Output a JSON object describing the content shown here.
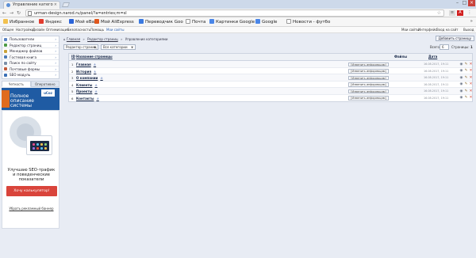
{
  "browser": {
    "tab_title": "Управление катего",
    "url": "urman-design.narod.ru/panel/?a=entries;m=sl",
    "bookmarks": [
      {
        "label": "Избранное",
        "color": "#f2c14e"
      },
      {
        "label": "Яндекс",
        "color": "#e23b2e"
      },
      {
        "label": "Мой eBay",
        "color": "#2b64d8"
      },
      {
        "label": "Мой AliExpress",
        "color": "#e0571c"
      },
      {
        "label": "Переводчик Goo",
        "color": "#3a79e0"
      },
      {
        "label": "Почта",
        "color": "#f6f6f6"
      },
      {
        "label": "Картинки Google",
        "color": "#4a86e8"
      },
      {
        "label": "Google",
        "color": "#4a86e8"
      },
      {
        "label": "Новости - футбо",
        "color": "#f6f6f6"
      }
    ],
    "bookmarks_more": "»",
    "ya_bar_left": [
      "Общее",
      "Настройки",
      "Дизайн",
      "Оптимизация",
      "Безопасность",
      "Помощь",
      "Мои сайты"
    ],
    "ya_bar_right": [
      "Мои сайты",
      "Интерфейс",
      "Вход на сайт",
      "Выход"
    ]
  },
  "sidebar": {
    "menu": [
      {
        "label": "Пользователи",
        "color": "#5a83c4"
      },
      {
        "label": "Редактор страниц",
        "color": "#4f9b46"
      },
      {
        "label": "Менеджер файлов",
        "color": "#c9a33a"
      },
      {
        "label": "Гостевая книга",
        "color": "#4c7bb8"
      },
      {
        "label": "Поиск по сайту",
        "color": "#7b8fa8"
      },
      {
        "label": "Почтовые формы",
        "color": "#c05a3a"
      },
      {
        "label": "SEO модуль",
        "color": "#3a6fb5"
      }
    ],
    "tabs": [
      "Четкость",
      "Оперативно"
    ],
    "promo1_text": [
      "Полное",
      "описание",
      "системы"
    ],
    "promo1_badge": "uCoz",
    "promo2": {
      "title_lines": [
        "Улучшаю SEO-трафик",
        "и поведенческие",
        "показатели"
      ],
      "cta": "Хочу калькулятор!",
      "banner_link": "Убрать рекламный баннер"
    }
  },
  "main": {
    "breadcrumbs": [
      "Главная",
      "Редактор страниц",
      "Управление категориями"
    ],
    "add_button": "Добавить страницу",
    "filter_section": "Редактор страниц",
    "filter_category": "Все категории",
    "pager_label": "Всего",
    "pager_value": "6",
    "pages_label": "Страницы:",
    "pages_value": "1",
    "columns": {
      "id": "ID",
      "title": "Название страницы",
      "files": "Файлы",
      "date": "Дата"
    },
    "rows": [
      {
        "num": "1",
        "name": "Главная",
        "info": "[Изменить информацию]",
        "date": "16.08.2017, 19:11"
      },
      {
        "num": "2",
        "name": "История",
        "info": "[Изменить информацию]",
        "date": "16.08.2017, 19:11"
      },
      {
        "num": "3",
        "name": "О компании",
        "info": "[Изменить информацию]",
        "date": "16.08.2017, 19:11"
      },
      {
        "num": "4",
        "name": "Клиенты",
        "info": "[Изменить информацию]",
        "date": "16.08.2017, 19:11"
      },
      {
        "num": "5",
        "name": "Проекты",
        "info": "[Изменить информацию]",
        "date": "16.08.2017, 19:11"
      },
      {
        "num": "6",
        "name": "Контакты",
        "info": "[Изменить информацию]",
        "date": "16.08.2017, 19:11"
      }
    ],
    "row_edit_mark": "±"
  }
}
